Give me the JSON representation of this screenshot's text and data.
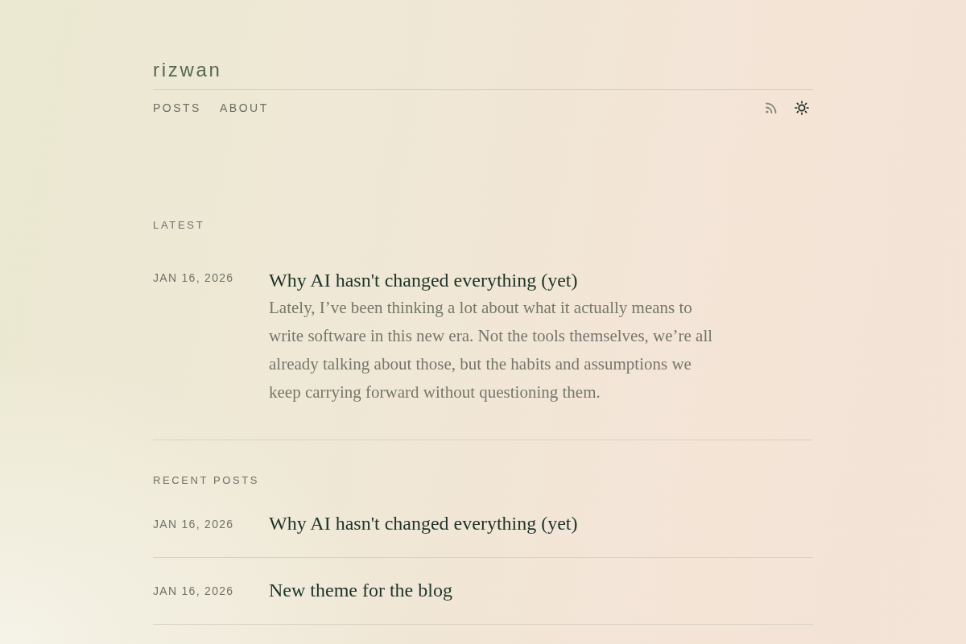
{
  "site": {
    "title": "rizwan"
  },
  "nav": {
    "links": [
      "POSTS",
      "ABOUT"
    ]
  },
  "latest": {
    "heading": "LATEST",
    "post": {
      "date": "JAN 16, 2026",
      "title": "Why AI hasn't changed everything (yet)",
      "excerpt": "Lately, I’ve been thinking a lot about what it actually means to write software in this new era. Not the tools themselves, we’re all already talking about those, but the habits and assumptions we keep carrying forward without questioning them."
    }
  },
  "recent_posts": {
    "heading": "RECENT POSTS",
    "posts": [
      {
        "date": "JAN 16, 2026",
        "title": "Why AI hasn't changed everything (yet)"
      },
      {
        "date": "JAN 16, 2026",
        "title": "New theme for the blog"
      }
    ]
  }
}
